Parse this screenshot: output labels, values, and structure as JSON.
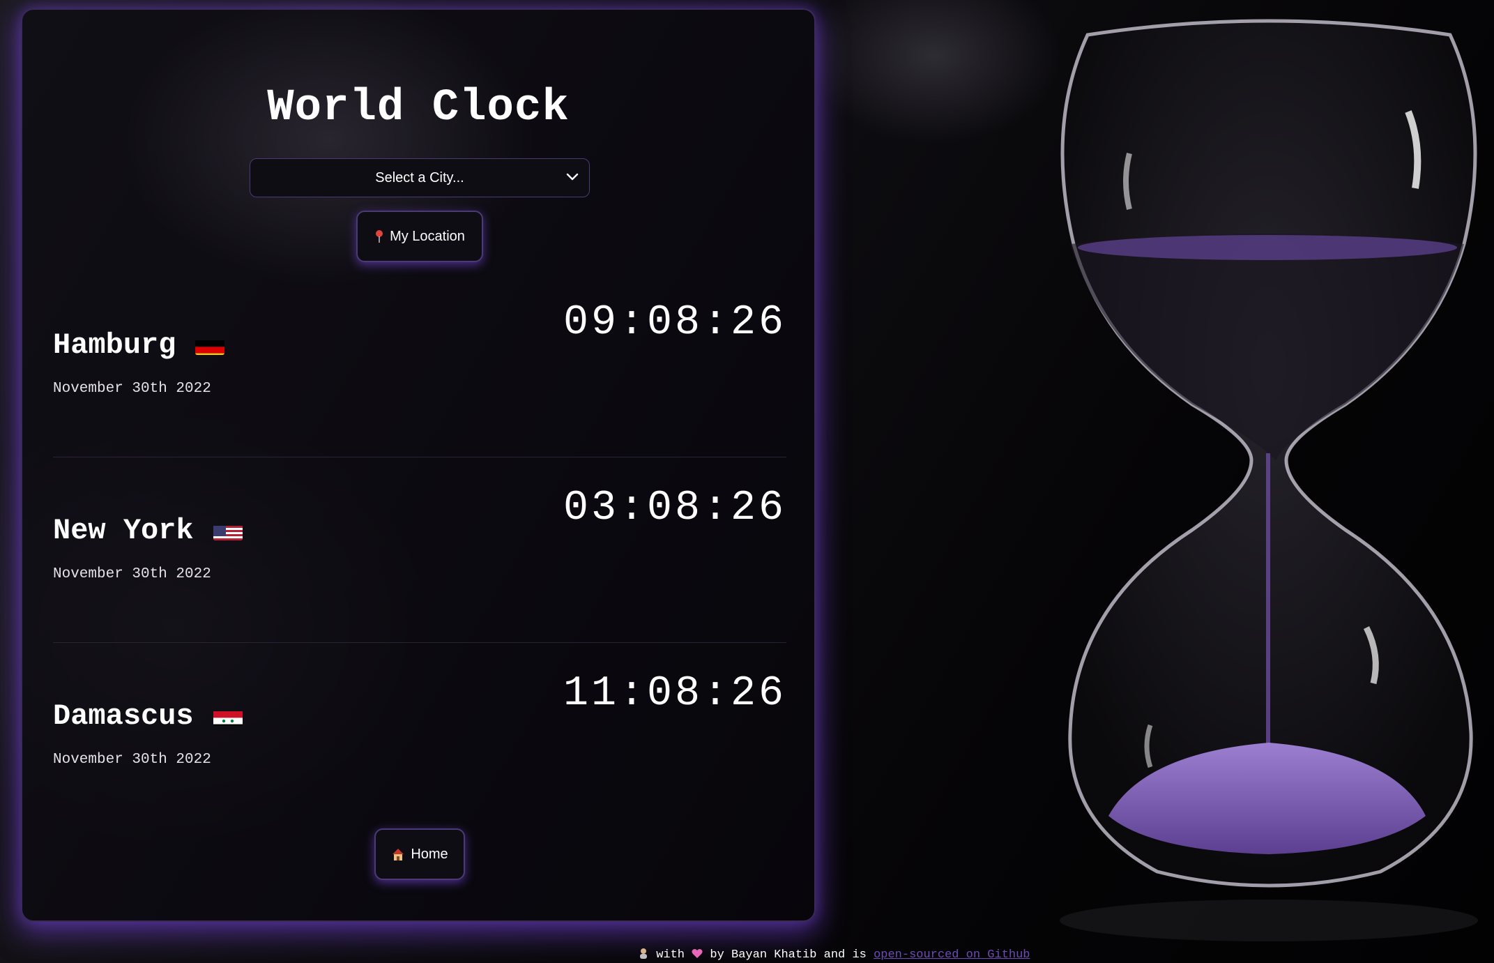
{
  "app": {
    "title": "World Clock"
  },
  "controls": {
    "city_select_value": "Select a City...",
    "location_button_label": "My Location",
    "home_button_label": "Home"
  },
  "cities": [
    {
      "name": "Hamburg",
      "flag": "germany-flag",
      "date": "November 30th 2022",
      "time": "09:08:26"
    },
    {
      "name": "New York",
      "flag": "usa-flag",
      "date": "November 30th 2022",
      "time": "03:08:26"
    },
    {
      "name": "Damascus",
      "flag": "syria-flag",
      "date": "November 30th 2022",
      "time": "11:08:26"
    }
  ],
  "footer": {
    "text_1": "with",
    "text_2": "by Bayan Khatib and is",
    "link": "open-sourced on Github"
  },
  "colors": {
    "accent": "#7a4fd6",
    "card_border": "#3a2a5a",
    "sand": "#7e5db3"
  }
}
